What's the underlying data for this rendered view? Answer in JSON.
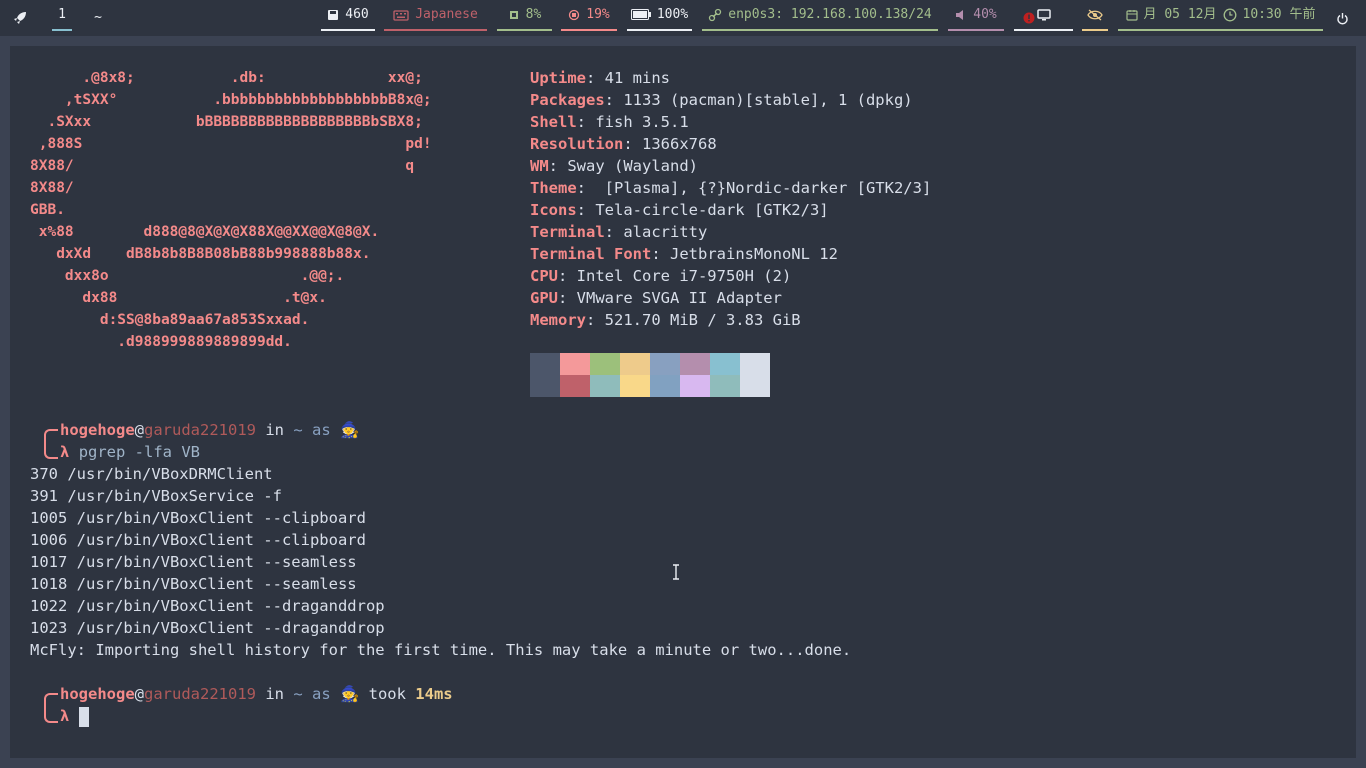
{
  "topbar": {
    "workspace_active": "1",
    "workspace_other": "~",
    "disk": "460",
    "keyboard": "Japanese",
    "cpu": "8%",
    "memory": "19%",
    "battery": "100%",
    "network": "enp0s3: 192.168.100.138/24",
    "volume": "40%",
    "calendar": "月 05 12月",
    "clock": "10:30 午前",
    "colors": {
      "disk": "#eceff4",
      "keyboard": "#bf616a",
      "cpu": "#a3be8c",
      "memory": "#f48a8a",
      "battery": "#eceff4",
      "network": "#a3be8c",
      "volume": "#b48ead",
      "misc": "#eceff4",
      "eye": "#ebcb8b",
      "clock": "#a3be8c"
    }
  },
  "neofetch": {
    "art": [
      "      .@8x8;           .db:              xx@;",
      "    ,tSXX°           .bbbbbbbbbbbbbbbbbbbB8x@;",
      "  .SXxx            bBBBBBBBBBBBBBBBBBBBbSBX8;",
      " ,888S                                     pd!",
      "8X88/                                      q",
      "8X88/",
      "GBB.",
      " x%88        d888@8@X@X@X88X@@XX@@X@8@X.",
      "   dxXd    dB8b8b8B8B08bB88b998888b88x.",
      "    dxx8o                      .@@;.",
      "      dx88                   .t@x.",
      "        d:SS@8ba89aa67a853Sxxad.",
      "          .d988999889889899dd."
    ],
    "info": [
      {
        "key": "Uptime",
        "value": ": 41 mins"
      },
      {
        "key": "Packages",
        "value": ": 1133 (pacman)[stable], 1 (dpkg)"
      },
      {
        "key": "Shell",
        "value": ": fish 3.5.1"
      },
      {
        "key": "Resolution",
        "value": ": 1366x768"
      },
      {
        "key": "WM",
        "value": ": Sway (Wayland)"
      },
      {
        "key": "Theme",
        "value": ":  [Plasma], {?}Nordic-darker [GTK2/3]"
      },
      {
        "key": "Icons",
        "value": ": Tela-circle-dark [GTK2/3]"
      },
      {
        "key": "Terminal",
        "value": ": alacritty"
      },
      {
        "key": "Terminal Font",
        "value": ": JetbrainsMonoNL 12"
      },
      {
        "key": "CPU",
        "value": ": Intel Core i7-9750H (2)"
      },
      {
        "key": "GPU",
        "value": ": VMware SVGA II Adapter"
      },
      {
        "key": "Memory",
        "value": ": 521.70 MiB / 3.83 GiB"
      }
    ],
    "palette_top": [
      "#4c566a",
      "#f4999a",
      "#9cc07b",
      "#eecb8b",
      "#88a0c0",
      "#b48ead",
      "#88c0d0",
      "#d8dee9"
    ],
    "palette_bottom": [
      "#4c566a",
      "#bf616a",
      "#8fbcbb",
      "#f9d889",
      "#81a1c1",
      "#d8b8f0",
      "#8fbcbb",
      "#d8dee9"
    ]
  },
  "session": {
    "prompt1": {
      "user": "hogehoge",
      "at": "@",
      "host": "garuda221019",
      "in": " in ",
      "dir": "~",
      "as": " as ",
      "emoji": "🧙",
      "lambda": "λ",
      "command": "pgrep -lfa VB"
    },
    "output": [
      "370 /usr/bin/VBoxDRMClient",
      "391 /usr/bin/VBoxService -f",
      "1005 /usr/bin/VBoxClient --clipboard",
      "1006 /usr/bin/VBoxClient --clipboard",
      "1017 /usr/bin/VBoxClient --seamless",
      "1018 /usr/bin/VBoxClient --seamless",
      "1022 /usr/bin/VBoxClient --draganddrop",
      "1023 /usr/bin/VBoxClient --draganddrop",
      "McFly: Importing shell history for the first time. This may take a minute or two...done."
    ],
    "prompt2": {
      "user": "hogehoge",
      "at": "@",
      "host": "garuda221019",
      "in": " in ",
      "dir": "~",
      "as": " as ",
      "emoji": "🧙",
      "took": " took ",
      "duration": "14ms",
      "lambda": "λ"
    }
  }
}
